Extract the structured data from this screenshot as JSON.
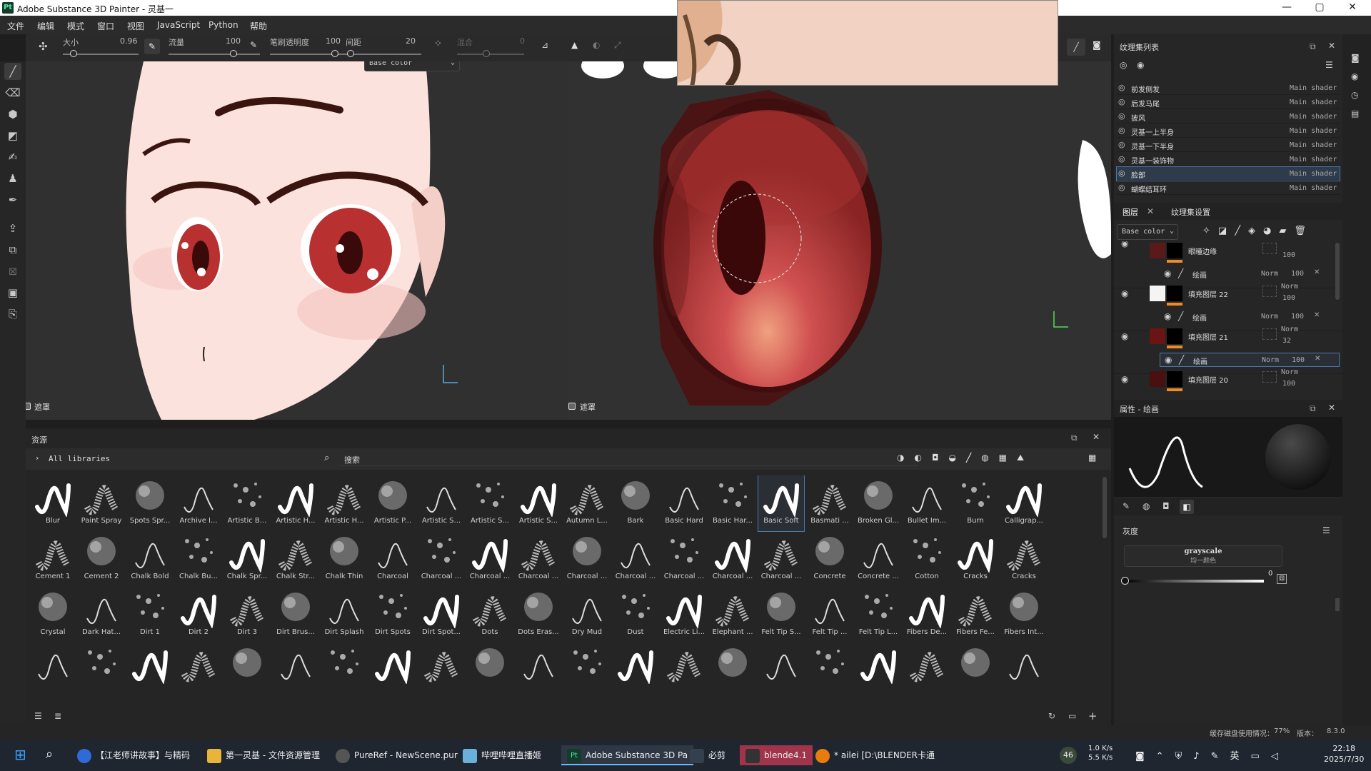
{
  "window": {
    "title": "Adobe Substance 3D Painter - 灵基一",
    "logo": "Pt",
    "min": "—",
    "max": "▢",
    "close": "✕"
  },
  "menus": [
    "文件",
    "编辑",
    "模式",
    "窗口",
    "视图",
    "JavaScript",
    "Python",
    "帮助"
  ],
  "toolbar": {
    "size_label": "大小",
    "size_value": "0.96",
    "flow_label": "流量",
    "flow_value": "100",
    "opacity_label": "笔刷透明度",
    "opacity_value": "100",
    "spacing_label": "间距",
    "spacing_value": "20",
    "angle_label": "混合",
    "angle_value": "0"
  },
  "viewport3d": {
    "channel": "Base color",
    "footer": "遮罩"
  },
  "viewport2d": {
    "footer": "遮罩"
  },
  "assets": {
    "title": "资源",
    "breadcrumb": "All libraries",
    "search_placeholder": "搜索",
    "brushes": [
      [
        "Blur",
        "Paint Spray",
        "Spots Spr...",
        "Archive I...",
        "Artistic B...",
        "Artistic H...",
        "Artistic H...",
        "Artistic P...",
        "Artistic S...",
        "Artistic S...",
        "Artistic S...",
        "Autumn L...",
        "Bark",
        "Basic Hard",
        "Basic Har...",
        "Basic Soft",
        "Basmati ...",
        "Broken Gl...",
        "Bullet Im...",
        "Burn",
        "Calligrap..."
      ],
      [
        "Cement 1",
        "Cement 2",
        "Chalk Bold",
        "Chalk Bu...",
        "Chalk Spr...",
        "Chalk Str...",
        "Chalk Thin",
        "Charcoal",
        "Charcoal ...",
        "Charcoal ...",
        "Charcoal ...",
        "Charcoal ...",
        "Charcoal ...",
        "Charcoal ...",
        "Charcoal ...",
        "Charcoal ...",
        "Concrete",
        "Concrete ...",
        "Cotton",
        "Cracks",
        "Cracks"
      ],
      [
        "Crystal",
        "Dark Hat...",
        "Dirt 1",
        "Dirt 2",
        "Dirt 3",
        "Dirt Brus...",
        "Dirt Splash",
        "Dirt Spots",
        "Dirt Spot...",
        "Dots",
        "Dots Eras...",
        "Dry Mud",
        "Dust",
        "Electric Li...",
        "Elephant ...",
        "Felt Tip S...",
        "Felt Tip ...",
        "Felt Tip L...",
        "Fibers De...",
        "Fibers Fe...",
        "Fibers Int..."
      ],
      [
        "",
        "",
        "",
        "",
        "",
        "",
        "",
        "",
        "",
        "",
        "",
        "",
        "",
        "",
        "",
        "",
        "",
        "",
        "",
        "",
        ""
      ]
    ],
    "selected": "Basic Soft"
  },
  "texture_sets": {
    "title": "纹理集列表",
    "items": [
      {
        "name": "前发侧发",
        "shader": "Main shader"
      },
      {
        "name": "后发马尾",
        "shader": "Main shader"
      },
      {
        "name": "披风",
        "shader": "Main shader"
      },
      {
        "name": "灵基一上半身",
        "shader": "Main shader"
      },
      {
        "name": "灵基一下半身",
        "shader": "Main shader"
      },
      {
        "name": "灵基一装饰物",
        "shader": "Main shader"
      },
      {
        "name": "脸部",
        "shader": "Main shader"
      },
      {
        "name": "蝴蝶结耳环",
        "shader": "Main shader"
      }
    ]
  },
  "layers": {
    "tab_layers": "图层",
    "tab_settings": "纹理集设置",
    "channel": "Base color",
    "items": [
      {
        "name": "眼瞳边缘",
        "blend": "",
        "opacity": "100",
        "sub": "绘画",
        "sub_blend": "Norm",
        "sub_opacity": "100",
        "color": "#5a1a1a"
      },
      {
        "name": "填充图层 22",
        "blend": "Norm",
        "opacity": "100",
        "sub": "绘画",
        "sub_blend": "Norm",
        "sub_opacity": "100",
        "color": "#f4f4f4"
      },
      {
        "name": "填充图层 21",
        "blend": "Norm",
        "opacity": "32",
        "sub": "绘画",
        "sub_blend": "Norm",
        "sub_opacity": "100",
        "color": "#6b1414"
      },
      {
        "name": "填充图层 20",
        "blend": "Norm",
        "opacity": "100",
        "sub": "绘画",
        "sub_blend": "Norm",
        "sub_opacity": "100",
        "color": "#4a1010"
      }
    ]
  },
  "properties": {
    "title": "属性 - 绘画",
    "section": "灰度",
    "value_name": "grayscale",
    "value_sub": "均一颜色",
    "value": "0"
  },
  "status": {
    "text": "缓存磁盘使用情况：",
    "pct": "77%",
    "ver_label": "版本：",
    "ver": "8.3.0"
  },
  "taskbar": {
    "items": [
      "【江老师讲故事】与精码",
      "第一灵基 - 文件资源管理",
      "PureRef - NewScene.pur",
      "哔哩哔哩直播姬",
      "Adobe Substance 3D Pa",
      "必剪",
      "blende4.1",
      "* ailei [D:\\BLENDER卡通"
    ],
    "weather": "46",
    "net_up": "1.0 K/s",
    "net_down": "5.5 K/s",
    "ime": "英",
    "time": "22:18",
    "date": "2025/7/30"
  }
}
